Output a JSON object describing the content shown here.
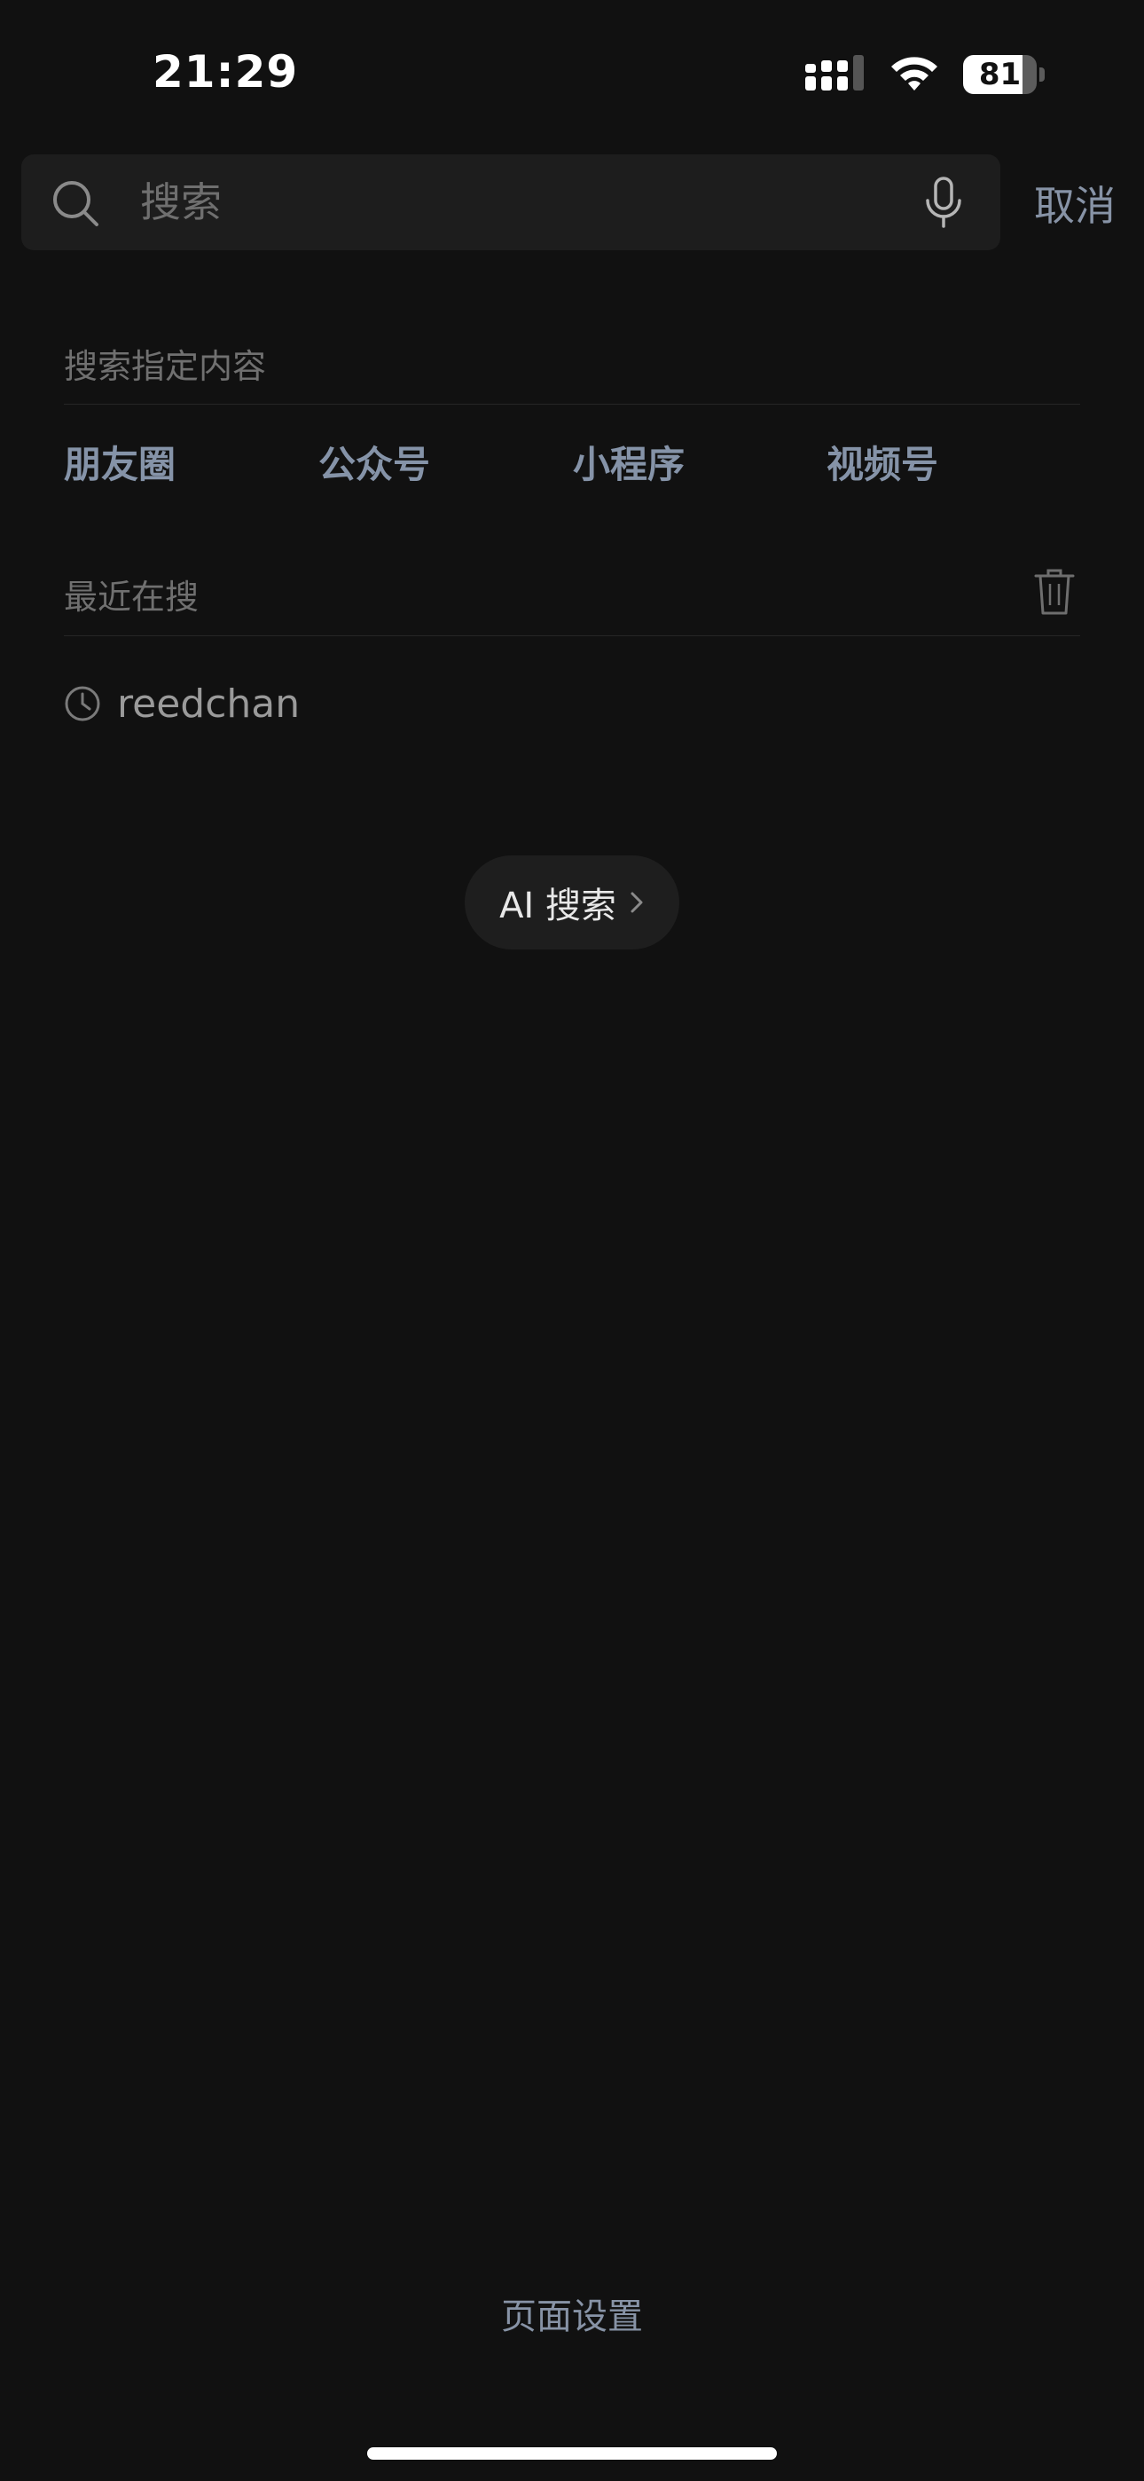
{
  "status_bar": {
    "time": "21:29",
    "battery_level": "81",
    "battery_fraction": 0.81
  },
  "search": {
    "placeholder": "搜索",
    "value": "",
    "cancel_label": "取消"
  },
  "specified_content": {
    "title": "搜索指定内容",
    "categories": [
      "朋友圈",
      "公众号",
      "小程序",
      "视频号"
    ]
  },
  "recent": {
    "title": "最近在搜",
    "items": [
      "reedchan"
    ]
  },
  "ai_search": {
    "label": "AI 搜索"
  },
  "footer": {
    "page_settings_label": "页面设置"
  },
  "colors": {
    "background": "#111111",
    "accent": "#8593a8"
  }
}
